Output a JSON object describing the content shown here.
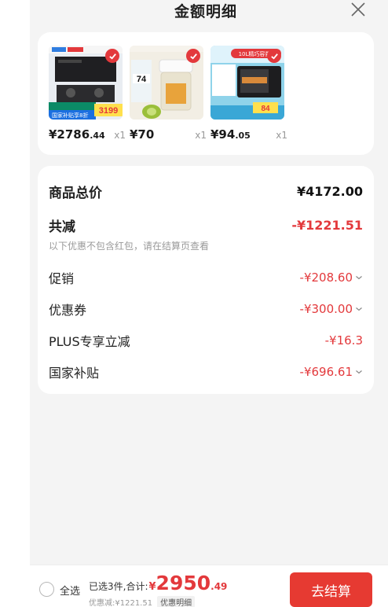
{
  "header": {
    "title": "金额明细"
  },
  "products": [
    {
      "price_int": "¥2786",
      "price_dec": ".44",
      "qty": "x1",
      "promo_tags": [
        "国家补贴享8折",
        "3199"
      ],
      "icon": "range-hood-stove-image"
    },
    {
      "price_int": "¥70",
      "price_dec": "",
      "qty": "x1",
      "promo_tags": [
        "74"
      ],
      "icon": "food-chopper-image"
    },
    {
      "price_int": "¥94",
      "price_dec": ".05",
      "qty": "x1",
      "promo_tags": [
        "10L精巧容量",
        "84"
      ],
      "icon": "toaster-oven-image"
    }
  ],
  "summary": {
    "total_label": "商品总价",
    "total_value": "¥4172.00",
    "reduce_label": "共减",
    "reduce_value": "-¥1221.51",
    "note": "以下优惠不包含红包，请在结算页查看",
    "items": [
      {
        "label": "促销",
        "value": "-¥208.60",
        "expandable": true
      },
      {
        "label": "优惠券",
        "value": "-¥300.00",
        "expandable": true
      },
      {
        "label": "PLUS专享立减",
        "value": "-¥16.3",
        "expandable": false
      },
      {
        "label": "国家补贴",
        "value": "-¥696.61",
        "expandable": true
      }
    ]
  },
  "bottom": {
    "select_all": "全选",
    "selected_text": "已选3件,合计:",
    "yen": "¥",
    "amount_int": "2950",
    "amount_dec": ".49",
    "discount_text": "优惠减:¥1221.51",
    "detail_link": "优惠明细",
    "checkout": "去结算"
  },
  "colors": {
    "accent": "#e3393c",
    "checkout_bg": "#e63a32",
    "sheet_bg": "#f4f4f4"
  }
}
